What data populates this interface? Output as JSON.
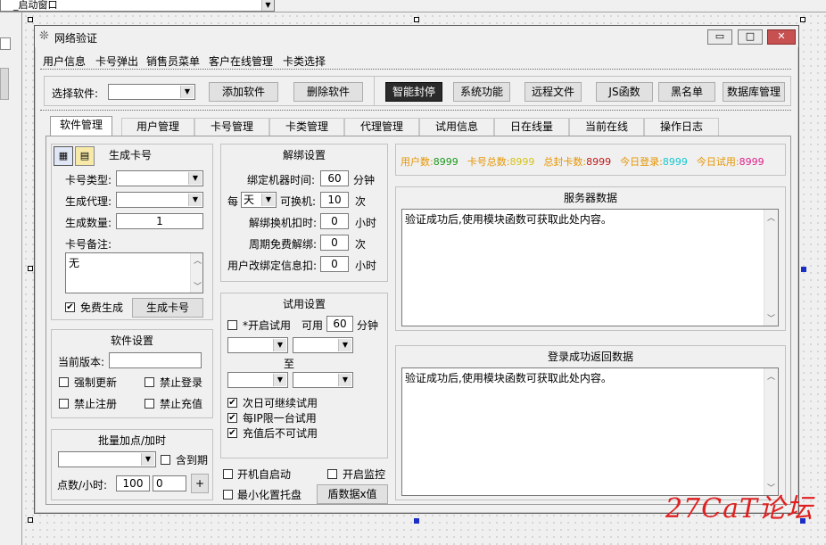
{
  "ide": {
    "combo_value": "_启动窗口",
    "combo_arrow": "▼"
  },
  "window": {
    "title": "网络验证",
    "controls": {
      "minimize": "▭",
      "maximize": "□",
      "close": "✕"
    }
  },
  "menu": [
    "用户信息",
    "卡号弹出",
    "销售员菜单",
    "客户在线管理",
    "卡类选择"
  ],
  "toolbar": {
    "select_label": "选择软件:",
    "select_value": "",
    "buttons": [
      "添加软件",
      "删除软件",
      "智能封停",
      "系统功能",
      "远程文件",
      "JS函数",
      "黑名单",
      "数据库管理"
    ]
  },
  "tabs": [
    "软件管理",
    "用户管理",
    "卡号管理",
    "卡类管理",
    "代理管理",
    "试用信息",
    "日在线量",
    "当前在线",
    "操作日志"
  ],
  "gen_card": {
    "title": "生成卡号",
    "card_type_label": "卡号类型:",
    "agent_label": "生成代理:",
    "count_label": "生成数量:",
    "count_value": "1",
    "note_label": "卡号备注:",
    "note_value": "无",
    "free_label": "免费生成",
    "free_checked": true,
    "generate_button": "生成卡号"
  },
  "software_settings": {
    "title": "软件设置",
    "version_label": "当前版本:",
    "force_update": "强制更新",
    "disable_login": "禁止登录",
    "disable_register": "禁止注册",
    "disable_recharge": "禁止充值"
  },
  "batch": {
    "title": "批量加点/加时",
    "include_expired": "含到期",
    "points_label": "点数/小时:",
    "value1": "100",
    "value2": "0",
    "plus": "+"
  },
  "unbind": {
    "title": "解绑设置",
    "bind_time_label": "绑定机器时间:",
    "bind_time_value": "60",
    "bind_time_unit": "分钟",
    "per_label": "每",
    "per_value": "天",
    "switch_label": "可换机:",
    "switch_value": "10",
    "switch_unit": "次",
    "deduct_label": "解绑换机扣时:",
    "deduct_value": "0",
    "deduct_unit": "小时",
    "free_label": "周期免费解绑:",
    "free_value": "0",
    "free_unit": "次",
    "user_change_label": "用户改绑定信息扣:",
    "user_change_value": "0",
    "user_change_unit": "小时"
  },
  "trial": {
    "title": "试用设置",
    "enable_label": "*开启试用",
    "available_label": "可用",
    "minutes_value": "60",
    "minutes_unit": "分钟",
    "to_label": "至",
    "next_day": "次日可继续试用",
    "per_ip": "每IP限一台试用",
    "after_recharge": "充值后不可试用"
  },
  "bottom_opts": {
    "autostart": "开机自启动",
    "monitor": "开启监控",
    "tray": "最小化置托盘",
    "shield_button": "盾数据x值"
  },
  "stats": [
    {
      "label": "用户数:",
      "value": "8999",
      "label_color": "#e69500",
      "value_color": "#1a9a1a"
    },
    {
      "label": "卡号总数:",
      "value": "8999",
      "label_color": "#e69500",
      "value_color": "#d4c21a"
    },
    {
      "label": "总封卡数:",
      "value": "8999",
      "label_color": "#e69500",
      "value_color": "#c01818"
    },
    {
      "label": "今日登录:",
      "value": "8999",
      "label_color": "#e69500",
      "value_color": "#18c8d0"
    },
    {
      "label": "今日试用:",
      "value": "8999",
      "label_color": "#e69500",
      "value_color": "#e0208c"
    }
  ],
  "server_data": {
    "title": "服务器数据",
    "content": "验证成功后,使用模块函数可获取此处内容。"
  },
  "login_data": {
    "title": "登录成功返回数据",
    "content": "验证成功后,使用模块函数可获取此处内容。"
  },
  "watermark": "27CaT论坛"
}
